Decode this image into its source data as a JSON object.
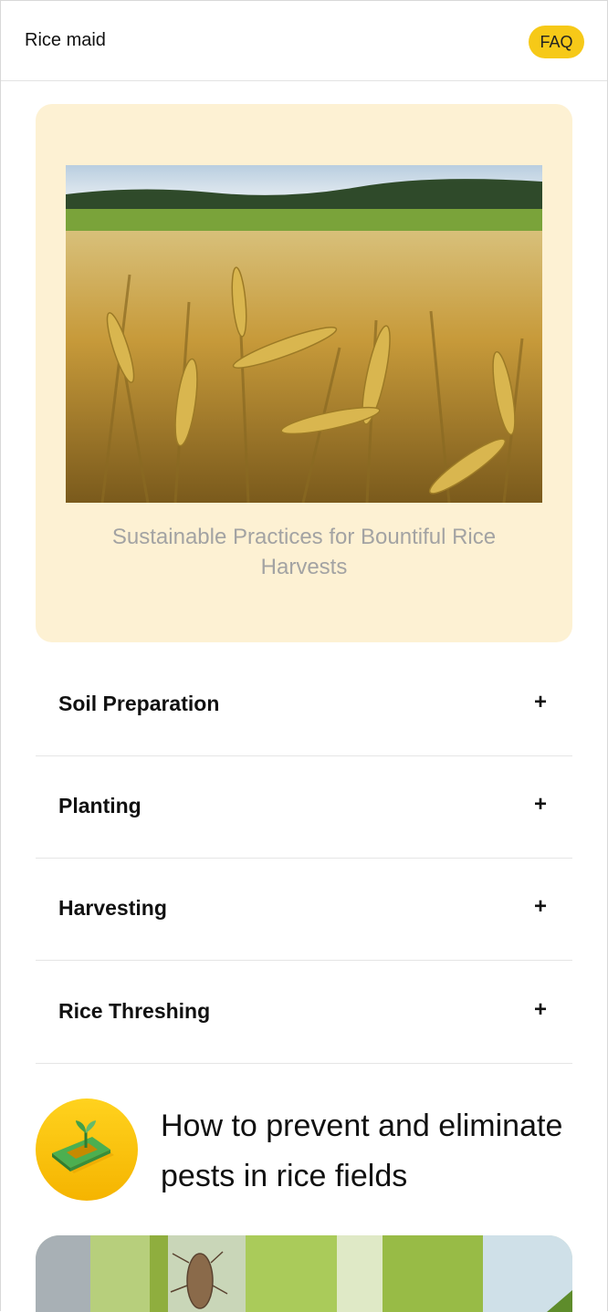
{
  "header": {
    "app_title": "Rice maid",
    "faq_label": "FAQ"
  },
  "hero": {
    "image_icon": "wheat-field-photo",
    "caption": "Sustainable Practices for Bountiful Rice Harvests"
  },
  "accordion": {
    "items": [
      {
        "label": "Soil Preparation",
        "toggle": "+"
      },
      {
        "label": "Planting",
        "toggle": "+"
      },
      {
        "label": "Harvesting",
        "toggle": "+"
      },
      {
        "label": "Rice Threshing",
        "toggle": "+"
      }
    ]
  },
  "pests": {
    "icon": "plant-sprout-icon",
    "heading": "How to prevent and eliminate pests in rice fields",
    "image_icon": "insect-on-rice-stalk-photo"
  },
  "colors": {
    "accent": "#f6c918",
    "hero_background": "#fdf1d3",
    "caption_text": "#a3a3a3"
  }
}
